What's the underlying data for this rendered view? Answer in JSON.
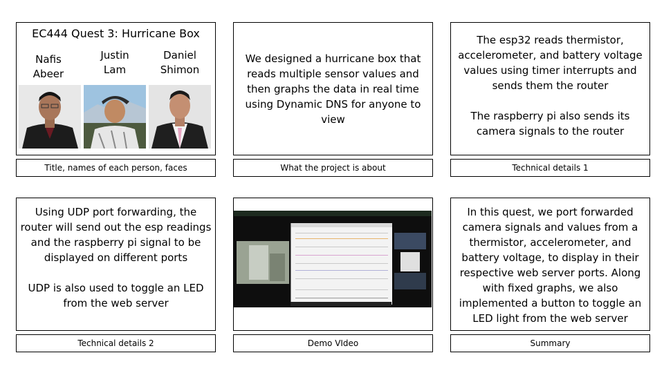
{
  "slide1": {
    "title": "EC444 Quest 3: Hurricane Box",
    "people": [
      {
        "first": "Nafis",
        "last": "Abeer"
      },
      {
        "first": "Justin",
        "last": "Lam"
      },
      {
        "first": "Daniel",
        "last": "Shimon"
      }
    ],
    "caption": "Title, names of each person, faces"
  },
  "slide2": {
    "lines": [
      "We designed  a hurricane box that",
      "reads multiple sensor values and",
      "then graphs the data in real time",
      "using Dynamic DNS for anyone to",
      "view"
    ],
    "caption": "What the project is about"
  },
  "slide3": {
    "p1": [
      "The esp32 reads thermistor,",
      "accelerometer, and battery voltage",
      "values using timer interrupts and",
      "sends them the router"
    ],
    "p2": [
      "The raspberry pi also sends its",
      "camera signals to the router"
    ],
    "caption": "Technical details 1"
  },
  "slide4": {
    "p1": [
      "Using UDP port forwarding, the",
      "router will send out the esp readings",
      "and the raspberry pi signal to be",
      "displayed on different ports"
    ],
    "p2": [
      "UDP is also used to toggle an LED",
      "from the web server"
    ],
    "caption": "Technical details 2"
  },
  "slide5": {
    "caption": "Demo VIdeo"
  },
  "slide6": {
    "lines": [
      "In this quest, we port forwarded",
      "camera signals and values from a",
      "thermistor, accelerometer, and",
      "battery voltage, to display in their",
      "respective web server ports. Along",
      "with fixed graphs, we also",
      "implemented a button to toggle an",
      "LED light from the web server"
    ],
    "caption": "Summary"
  }
}
